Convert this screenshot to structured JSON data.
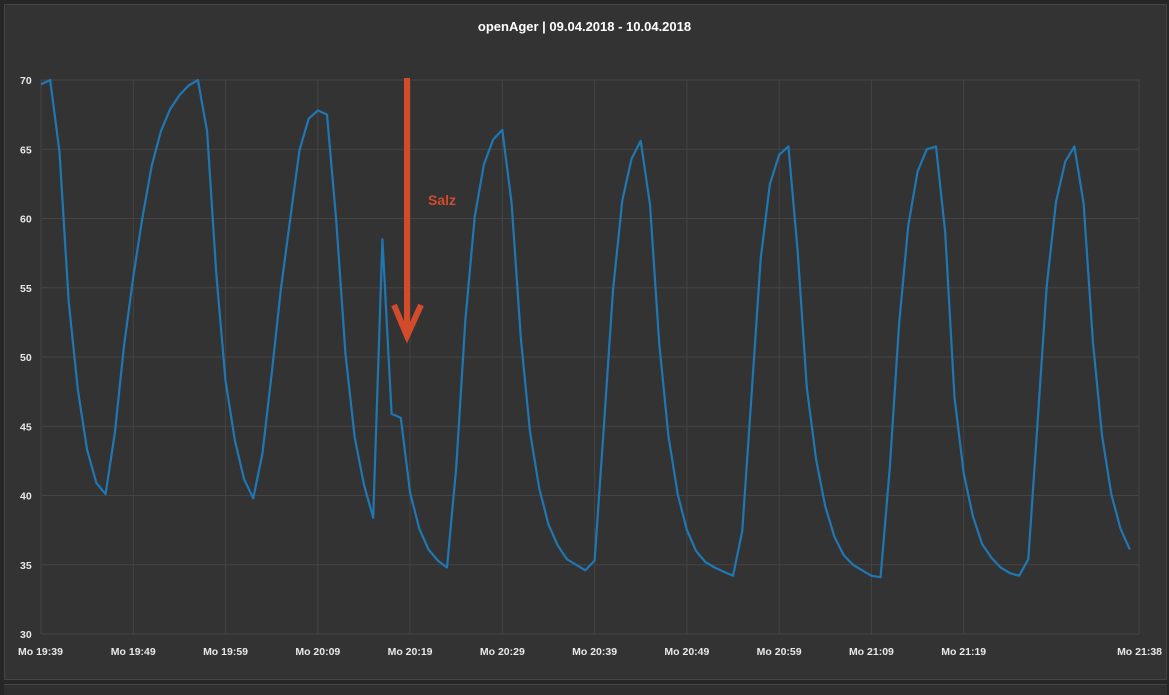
{
  "chart_data": {
    "type": "line",
    "title": "openAger | 09.04.2018 - 10.04.2018",
    "xlabel": "",
    "ylabel": "",
    "ylim": [
      30,
      70
    ],
    "yticks": [
      30,
      35,
      40,
      45,
      50,
      55,
      60,
      65,
      70
    ],
    "xlim": [
      "19:39",
      "21:38"
    ],
    "xticks": [
      "19:39",
      "19:49",
      "19:59",
      "20:09",
      "20:19",
      "20:29",
      "20:39",
      "20:49",
      "20:59",
      "21:09",
      "21:19",
      "21:38"
    ],
    "xtick_labels": [
      "Mo 19:39",
      "Mo 19:49",
      "Mo 19:59",
      "Mo 20:09",
      "Mo 20:19",
      "Mo 20:29",
      "Mo 20:39",
      "Mo 20:49",
      "Mo 20:59",
      "Mo 21:09",
      "Mo 21:19",
      "Mo 21:38"
    ],
    "grid": true,
    "series": [
      {
        "color": "#1f77b4",
        "points": [
          [
            "19:39",
            69.7
          ],
          [
            "19:40",
            70.0
          ],
          [
            "19:41",
            64.8
          ],
          [
            "19:42",
            54.0
          ],
          [
            "19:43",
            47.6
          ],
          [
            "19:44",
            43.3
          ],
          [
            "19:45",
            40.9
          ],
          [
            "19:46",
            40.1
          ],
          [
            "19:47",
            44.5
          ],
          [
            "19:48",
            50.8
          ],
          [
            "19:49",
            55.8
          ],
          [
            "19:50",
            60.1
          ],
          [
            "19:51",
            63.8
          ],
          [
            "19:52",
            66.3
          ],
          [
            "19:53",
            67.9
          ],
          [
            "19:54",
            68.9
          ],
          [
            "19:55",
            69.6
          ],
          [
            "19:56",
            70.0
          ],
          [
            "19:57",
            66.3
          ],
          [
            "19:58",
            56.0
          ],
          [
            "19:59",
            48.3
          ],
          [
            "20:00",
            44.0
          ],
          [
            "20:01",
            41.2
          ],
          [
            "20:02",
            39.8
          ],
          [
            "20:03",
            43.0
          ],
          [
            "20:04",
            48.8
          ],
          [
            "20:05",
            54.9
          ],
          [
            "20:06",
            59.9
          ],
          [
            "20:07",
            64.9
          ],
          [
            "20:08",
            67.2
          ],
          [
            "20:09",
            67.8
          ],
          [
            "20:10",
            67.5
          ],
          [
            "20:11",
            59.8
          ],
          [
            "20:12",
            50.2
          ],
          [
            "20:13",
            44.2
          ],
          [
            "20:14",
            40.8
          ],
          [
            "20:15",
            38.4
          ],
          [
            "20:16",
            58.5
          ],
          [
            "20:17",
            45.9
          ],
          [
            "20:18",
            45.6
          ],
          [
            "20:19",
            40.2
          ],
          [
            "20:20",
            37.6
          ],
          [
            "20:21",
            36.1
          ],
          [
            "20:22",
            35.3
          ],
          [
            "20:23",
            34.8
          ],
          [
            "20:24",
            42.0
          ],
          [
            "20:25",
            52.7
          ],
          [
            "20:26",
            60.1
          ],
          [
            "20:27",
            63.9
          ],
          [
            "20:28",
            65.7
          ],
          [
            "20:29",
            66.4
          ],
          [
            "20:30",
            61.1
          ],
          [
            "20:31",
            51.4
          ],
          [
            "20:32",
            44.6
          ],
          [
            "20:33",
            40.5
          ],
          [
            "20:34",
            37.9
          ],
          [
            "20:35",
            36.4
          ],
          [
            "20:36",
            35.4
          ],
          [
            "20:37",
            35.0
          ],
          [
            "20:38",
            34.6
          ],
          [
            "20:39",
            35.3
          ],
          [
            "20:40",
            44.9
          ],
          [
            "20:41",
            54.9
          ],
          [
            "20:42",
            61.3
          ],
          [
            "20:43",
            64.3
          ],
          [
            "20:44",
            65.6
          ],
          [
            "20:45",
            61.0
          ],
          [
            "20:46",
            51.0
          ],
          [
            "20:47",
            44.3
          ],
          [
            "20:48",
            40.1
          ],
          [
            "20:49",
            37.5
          ],
          [
            "20:50",
            36.0
          ],
          [
            "20:51",
            35.2
          ],
          [
            "20:52",
            34.8
          ],
          [
            "20:53",
            34.5
          ],
          [
            "20:54",
            34.2
          ],
          [
            "20:55",
            37.4
          ],
          [
            "20:56",
            47.2
          ],
          [
            "20:57",
            57.1
          ],
          [
            "20:58",
            62.5
          ],
          [
            "20:59",
            64.6
          ],
          [
            "21:00",
            65.2
          ],
          [
            "21:01",
            57.7
          ],
          [
            "21:02",
            47.8
          ],
          [
            "21:03",
            42.6
          ],
          [
            "21:04",
            39.2
          ],
          [
            "21:05",
            37.0
          ],
          [
            "21:06",
            35.7
          ],
          [
            "21:07",
            35.0
          ],
          [
            "21:08",
            34.6
          ],
          [
            "21:09",
            34.2
          ],
          [
            "21:10",
            34.1
          ],
          [
            "21:11",
            42.1
          ],
          [
            "21:12",
            52.4
          ],
          [
            "21:13",
            59.5
          ],
          [
            "21:14",
            63.4
          ],
          [
            "21:15",
            65.0
          ],
          [
            "21:16",
            65.2
          ],
          [
            "21:17",
            59.0
          ],
          [
            "21:18",
            47.1
          ],
          [
            "21:19",
            41.6
          ],
          [
            "21:20",
            38.5
          ],
          [
            "21:21",
            36.5
          ],
          [
            "21:22",
            35.5
          ],
          [
            "21:23",
            34.8
          ],
          [
            "21:24",
            34.4
          ],
          [
            "21:25",
            34.2
          ],
          [
            "21:26",
            35.4
          ],
          [
            "21:27",
            45.2
          ],
          [
            "21:28",
            55.1
          ],
          [
            "21:29",
            61.2
          ],
          [
            "21:30",
            64.1
          ],
          [
            "21:31",
            65.2
          ],
          [
            "21:32",
            61.1
          ],
          [
            "21:33",
            51.1
          ],
          [
            "21:34",
            44.3
          ],
          [
            "21:35",
            40.1
          ],
          [
            "21:36",
            37.6
          ],
          [
            "21:37",
            36.1
          ]
        ]
      }
    ],
    "annotations": [
      {
        "text": "Salz",
        "color": "#d24b2b",
        "arrow": "down",
        "x": "20:19"
      }
    ]
  }
}
